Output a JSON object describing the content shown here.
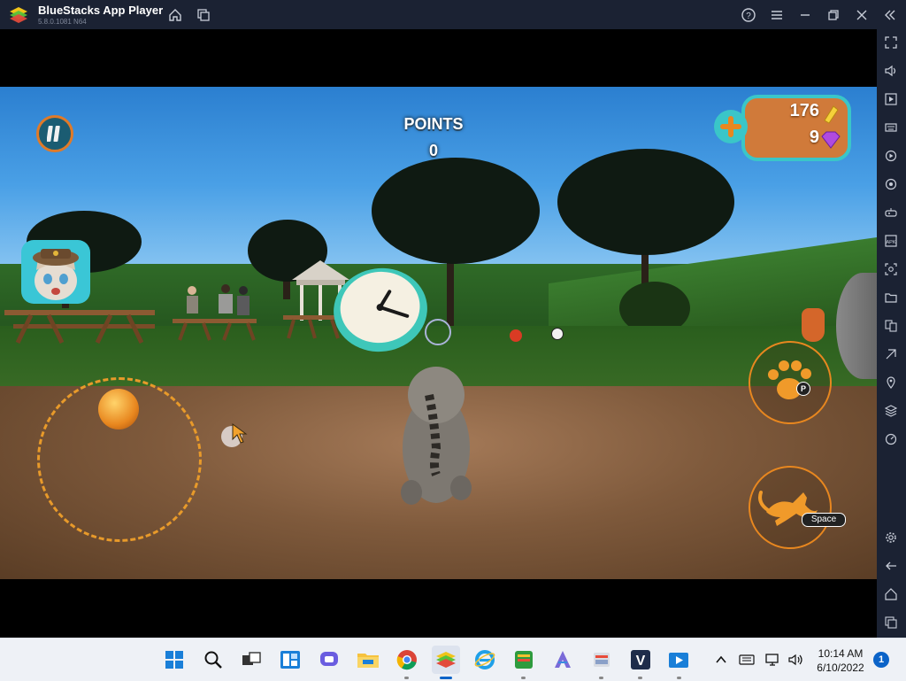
{
  "window": {
    "title": "BlueStacks App Player",
    "version": "5.8.0.1081 N64"
  },
  "titlebar_buttons": [
    "home-icon",
    "multi-instance-icon",
    "help-icon",
    "menu-icon",
    "minimize-icon",
    "restore-icon",
    "close-icon",
    "collapse-sidebar-icon"
  ],
  "sidebar_buttons": [
    "fullscreen-icon",
    "volume-icon",
    "media-icon",
    "keyboard-icon",
    "macro-icon",
    "rotate-icon",
    "controls-icon",
    "apk-icon",
    "screenshot-icon",
    "folder-icon",
    "multi-screen-icon",
    "eco-icon",
    "location-icon",
    "layers-icon",
    "performance-icon",
    "settings-icon",
    "back-icon",
    "android-home-icon",
    "recent-apps-icon"
  ],
  "game": {
    "points_label": "POINTS",
    "points_value": "0",
    "coins": "176",
    "gems": "9",
    "paw_key": "P",
    "jump_key": "Space"
  },
  "taskbar": {
    "apps": [
      "start-icon",
      "search-icon",
      "task-view-icon",
      "widgets-icon",
      "chat-icon",
      "file-explorer-icon",
      "chrome-icon",
      "bluestacks-icon",
      "internet-explorer-icon",
      "green-app-icon",
      "vector-app-icon",
      "tool-app-icon",
      "v-app-icon",
      "media-app-icon"
    ],
    "time": "10:14 AM",
    "date": "6/10/2022",
    "notifications": "1"
  },
  "colors": {
    "chrome_bg": "#1b2233",
    "accent_orange": "#e8871f",
    "accent_teal": "#3ac6c8",
    "taskbar_bg": "#eef1f6"
  }
}
